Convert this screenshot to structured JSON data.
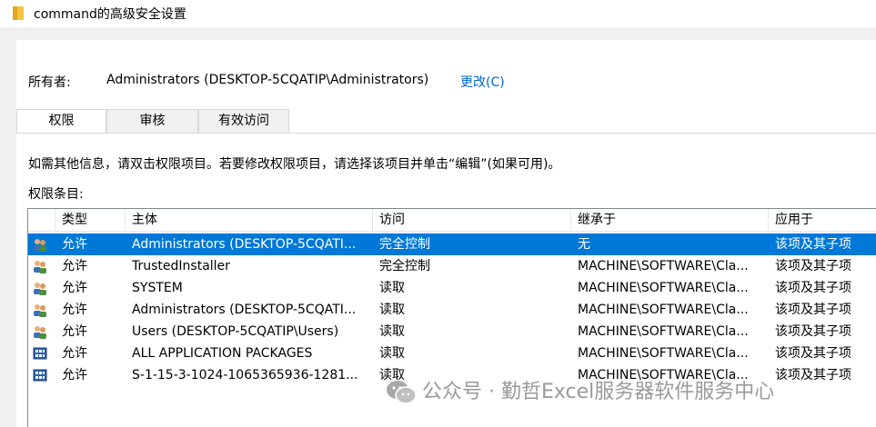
{
  "window": {
    "title": "command的高级安全设置"
  },
  "owner": {
    "label": "所有者:",
    "value": "Administrators (DESKTOP-5CQATIP\\Administrators)",
    "change_link": "更改(C)"
  },
  "tabs": [
    {
      "label": "权限",
      "active": true
    },
    {
      "label": "审核"
    },
    {
      "label": "有效访问"
    }
  ],
  "info_text": "如需其他信息，请双击权限项目。若要修改权限项目，请选择该项目并单击“编辑”(如果可用)。",
  "entries_label": "权限条目:",
  "columns": {
    "type": "类型",
    "principal": "主体",
    "access": "访问",
    "inherited": "继承于",
    "applies": "应用于"
  },
  "rows": [
    {
      "type": "允许",
      "principal": "Administrators (DESKTOP-5CQATI...",
      "access": "完全控制",
      "inherited": "无",
      "applies": "该项及其子项",
      "icon": "user-group-icon",
      "selected": true
    },
    {
      "type": "允许",
      "principal": "TrustedInstaller",
      "access": "完全控制",
      "inherited": "MACHINE\\SOFTWARE\\Cla...",
      "applies": "该项及其子项",
      "icon": "user-group-icon"
    },
    {
      "type": "允许",
      "principal": "SYSTEM",
      "access": "读取",
      "inherited": "MACHINE\\SOFTWARE\\Cla...",
      "applies": "该项及其子项",
      "icon": "user-group-icon"
    },
    {
      "type": "允许",
      "principal": "Administrators (DESKTOP-5CQATI...",
      "access": "读取",
      "inherited": "MACHINE\\SOFTWARE\\Cla...",
      "applies": "该项及其子项",
      "icon": "user-group-icon"
    },
    {
      "type": "允许",
      "principal": "Users (DESKTOP-5CQATIP\\Users)",
      "access": "读取",
      "inherited": "MACHINE\\SOFTWARE\\Cla...",
      "applies": "该项及其子项",
      "icon": "user-group-icon"
    },
    {
      "type": "允许",
      "principal": "ALL APPLICATION PACKAGES",
      "access": "读取",
      "inherited": "MACHINE\\SOFTWARE\\Cla...",
      "applies": "该项及其子项",
      "icon": "app-packages-icon"
    },
    {
      "type": "允许",
      "principal": "S-1-15-3-1024-1065365936-1281...",
      "access": "读取",
      "inherited": "MACHINE\\SOFTWARE\\Cla...",
      "applies": "该项及其子项",
      "icon": "app-packages-icon"
    }
  ],
  "watermark": {
    "text": "公众号 · 勤哲Excel服务器软件服务中心",
    "icon": "wechat-icon"
  },
  "colors": {
    "selection": "#0078d7",
    "link": "#0066cc"
  }
}
